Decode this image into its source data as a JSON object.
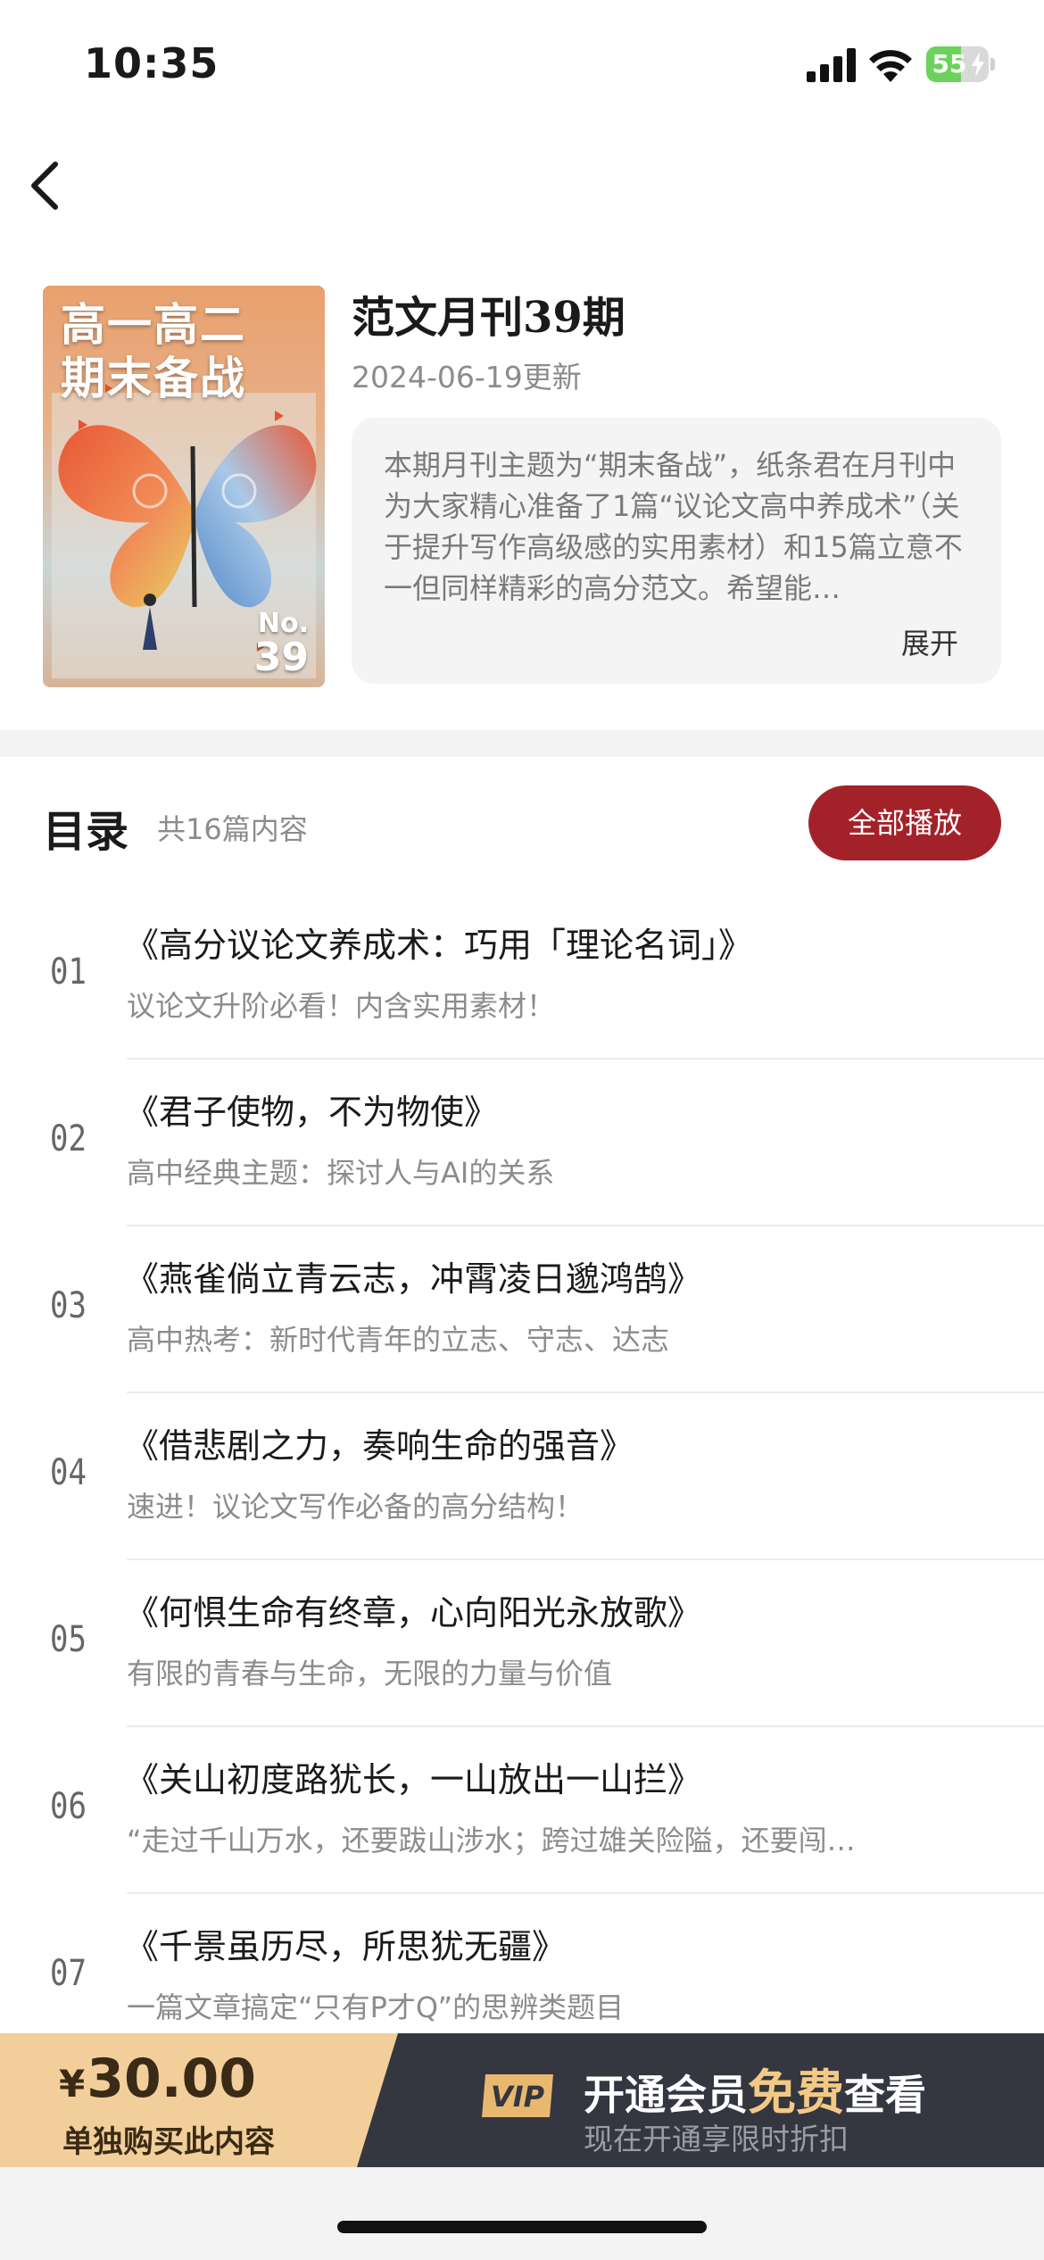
{
  "status_bar": {
    "time": "10:35",
    "battery": "55",
    "battery_level": 0.55
  },
  "magazine": {
    "cover_title_line1": "高一高二",
    "cover_title_line2": "期末备战",
    "cover_no_label": "No.",
    "cover_no_num": "39",
    "title": "范文月刊39期",
    "date": "2024-06-19更新",
    "description": "本期月刊主题为“期末备战”，纸条君在月刊中为大家精心准备了1篇“议论文高中养成术”（关于提升写作高级感的实用素材）和15篇立意不一但同样精彩的高分范文。希望能…",
    "expand_label": "展开"
  },
  "toc": {
    "title": "目录",
    "count": "共16篇内容",
    "play_all": "全部播放",
    "items": [
      {
        "num": "01",
        "title": "《高分议论文养成术：巧用「理论名词」》",
        "subtitle": "议论文升阶必看！内含实用素材！"
      },
      {
        "num": "02",
        "title": "《君子使物，不为物使》",
        "subtitle": "高中经典主题：探讨人与AI的关系"
      },
      {
        "num": "03",
        "title": "《燕雀倘立青云志，冲霄凌日邈鸿鹄》",
        "subtitle": "高中热考：新时代青年的立志、守志、达志"
      },
      {
        "num": "04",
        "title": "《借悲剧之力，奏响生命的强音》",
        "subtitle": "速进！议论文写作必备的高分结构！"
      },
      {
        "num": "05",
        "title": "《何惧生命有终章，心向阳光永放歌》",
        "subtitle": "有限的青春与生命，无限的力量与价值"
      },
      {
        "num": "06",
        "title": "《关山初度路犹长，一山放出一山拦》",
        "subtitle": "“走过千山万水，还要跋山涉水；跨过雄关险隘，还要闯…"
      },
      {
        "num": "07",
        "title": "《千景虽历尽，所思犹无疆》",
        "subtitle": "一篇文章搞定“只有P才Q”的思辨类题目"
      }
    ]
  },
  "purchase": {
    "currency": "¥",
    "price": "30.00",
    "buy_label": "单独购买此内容",
    "vip_badge": "VIP",
    "vip_pre": "开通会员",
    "vip_free": "免费",
    "vip_post": "查看",
    "vip_sub": "现在开通享限时折扣"
  },
  "colors": {
    "accent": "#a3222a",
    "buy_bg": "#f2cf9a",
    "vip_bg": "#343740",
    "vip_gold": "#f3c985"
  }
}
